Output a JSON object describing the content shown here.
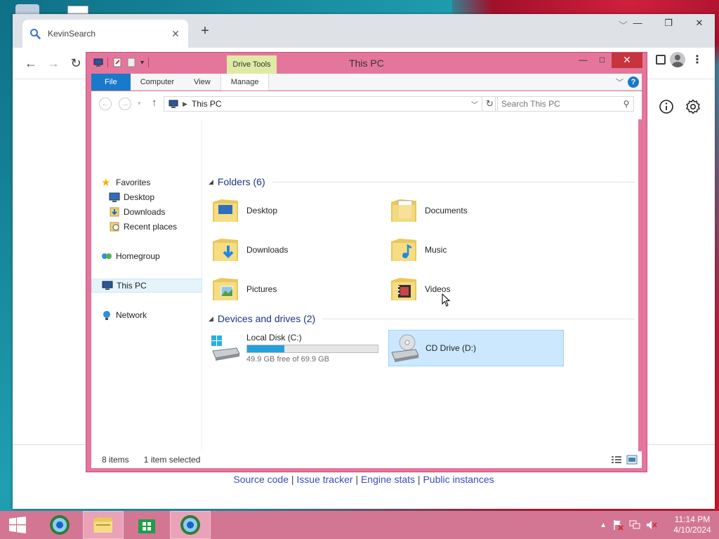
{
  "browser": {
    "tab_title": "KevinSearch",
    "tab_close": "✕",
    "new_tab": "+",
    "footer_links": [
      "Source code",
      "Issue tracker",
      "Engine stats",
      "Public instances"
    ],
    "footer_sep": "|"
  },
  "explorer": {
    "title": "This PC",
    "drive_tools_tab": "Drive Tools",
    "ribbon_tabs": [
      "File",
      "Computer",
      "View",
      "Manage"
    ],
    "address_path": "This PC",
    "search_placeholder": "Search This PC",
    "nav": {
      "favorites": "Favorites",
      "desktop": "Desktop",
      "downloads": "Downloads",
      "recent": "Recent places",
      "homegroup": "Homegroup",
      "this_pc": "This PC",
      "network": "Network"
    },
    "folders_header": "Folders (6)",
    "folders": [
      "Desktop",
      "Documents",
      "Downloads",
      "Music",
      "Pictures",
      "Videos"
    ],
    "devices_header": "Devices and drives (2)",
    "drives": [
      {
        "name": "Local Disk (C:)",
        "free_text": "49.9 GB free of 69.9 GB",
        "used_fraction": 0.286
      },
      {
        "name": "CD Drive (D:)"
      }
    ],
    "status_items": "8 items",
    "status_selected": "1 item selected"
  },
  "taskbar": {
    "time": "11:14 PM",
    "date": "4/10/2024"
  },
  "colors": {
    "explorer_frame": "#e4769c",
    "taskbar": "#d37694",
    "file_tab": "#1979ca",
    "drive_bar": "#26a0da",
    "selection": "#cce8ff"
  }
}
